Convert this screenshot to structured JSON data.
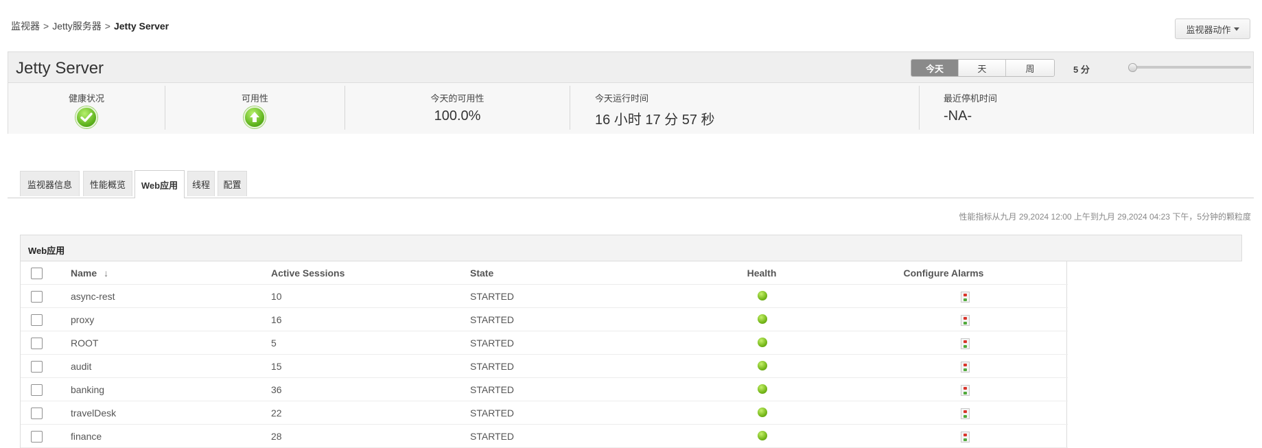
{
  "breadcrumb": {
    "items": [
      "监视器",
      "Jetty服务器"
    ],
    "separator": ">",
    "current": "Jetty Server"
  },
  "actions_button": {
    "label": "监视器动作"
  },
  "monitor": {
    "title": "Jetty Server",
    "periods": [
      {
        "label": "今天",
        "active": true
      },
      {
        "label": "天",
        "active": false
      },
      {
        "label": "周",
        "active": false
      }
    ],
    "interval_label": "5 分",
    "interval_slider": {
      "value": 0
    }
  },
  "metrics": {
    "health_label": "健康状况",
    "availability_label": "可用性",
    "today_availability_label": "今天的可用性",
    "today_availability_value": "100.0%",
    "uptime_label": "今天运行时间",
    "uptime_value": "16 小时 17 分 57 秒",
    "last_downtime_label": "最近停机时间",
    "last_downtime_value": "-NA-"
  },
  "tabs": [
    {
      "label": "监视器信息",
      "active": false
    },
    {
      "label": "性能概览",
      "active": false
    },
    {
      "label": "Web应用",
      "active": true
    },
    {
      "label": "线程",
      "active": false
    },
    {
      "label": "配置",
      "active": false
    }
  ],
  "period_note": "性能指标从九月 29,2024 12:00 上午到九月 29,2024 04:23 下午，5分钟的颗粒度",
  "webapps": {
    "panel_title": "Web应用",
    "columns": {
      "name": "Name",
      "sort_indicator": "↓",
      "sessions": "Active Sessions",
      "state": "State",
      "health": "Health",
      "alarms": "Configure Alarms"
    },
    "rows": [
      {
        "name": "async-rest",
        "sessions": "10",
        "state": "STARTED"
      },
      {
        "name": "proxy",
        "sessions": "16",
        "state": "STARTED"
      },
      {
        "name": "ROOT",
        "sessions": "5",
        "state": "STARTED"
      },
      {
        "name": "audit",
        "sessions": "15",
        "state": "STARTED"
      },
      {
        "name": "banking",
        "sessions": "36",
        "state": "STARTED"
      },
      {
        "name": "travelDesk",
        "sessions": "22",
        "state": "STARTED"
      },
      {
        "name": "finance",
        "sessions": "28",
        "state": "STARTED"
      }
    ]
  },
  "colors": {
    "accent_active_tab": "#8a8a8a",
    "health_green": "#76b81a",
    "alarm_red": "#d9342b",
    "alarm_green": "#4fa93a"
  }
}
